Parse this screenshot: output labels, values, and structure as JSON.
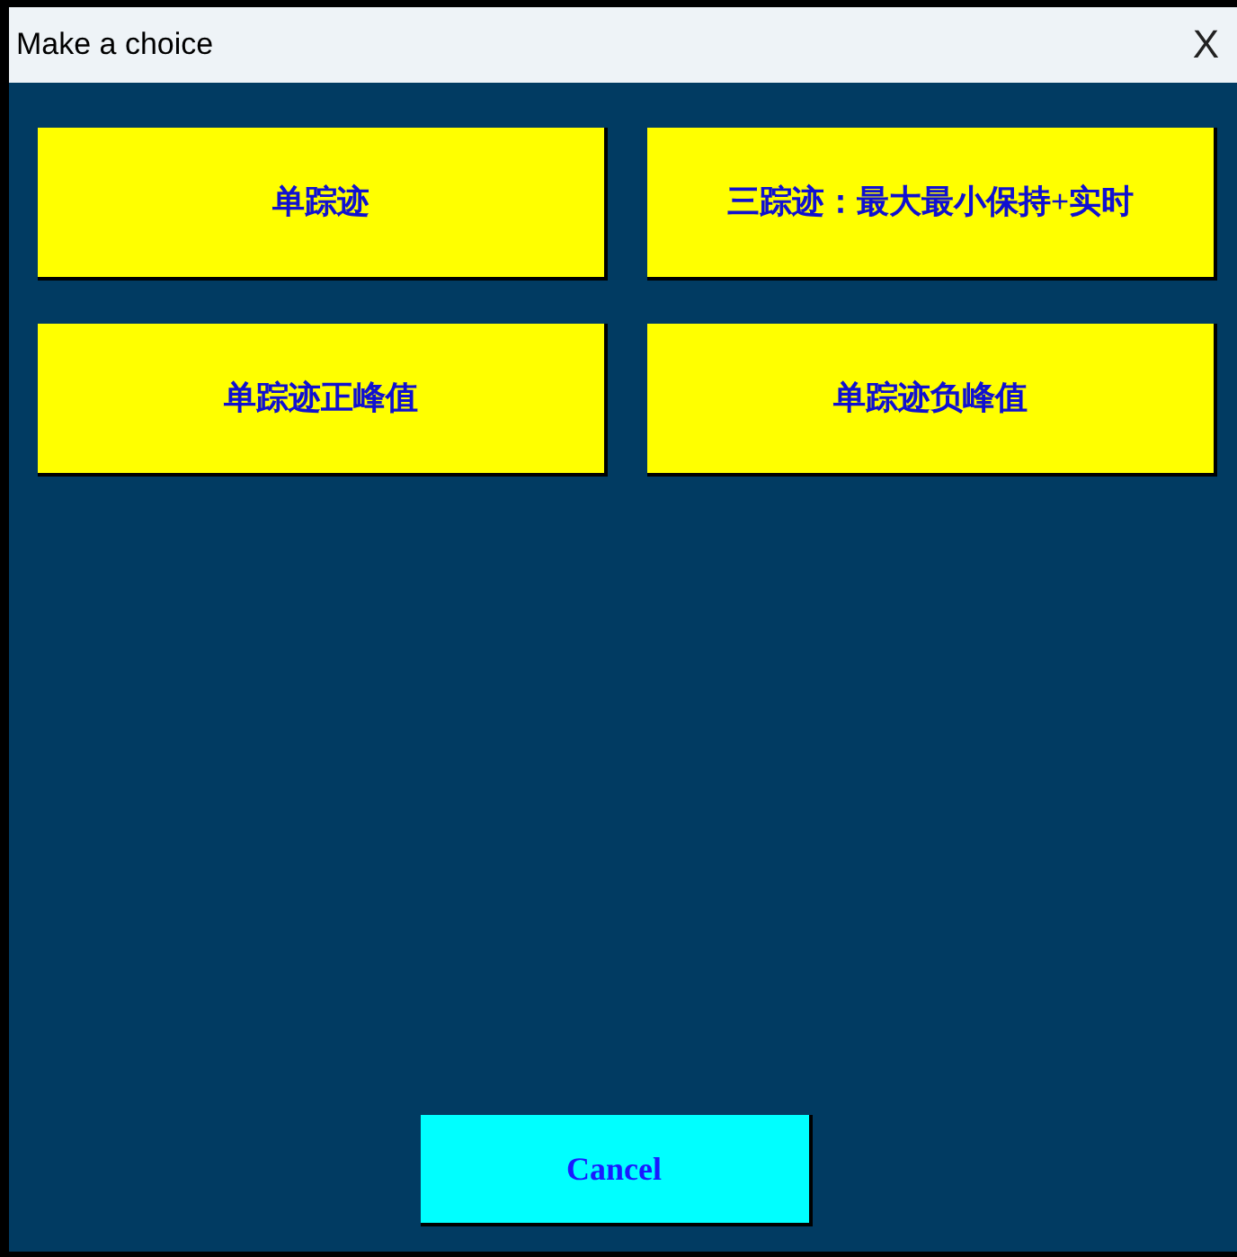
{
  "window": {
    "title": "Make a choice",
    "close": "X"
  },
  "choices": [
    {
      "label": "单踪迹"
    },
    {
      "label": "三踪迹：最大最小保持+实时"
    },
    {
      "label": "单踪迹正峰值"
    },
    {
      "label": "单踪迹负峰值"
    }
  ],
  "cancel": {
    "label": "Cancel"
  }
}
